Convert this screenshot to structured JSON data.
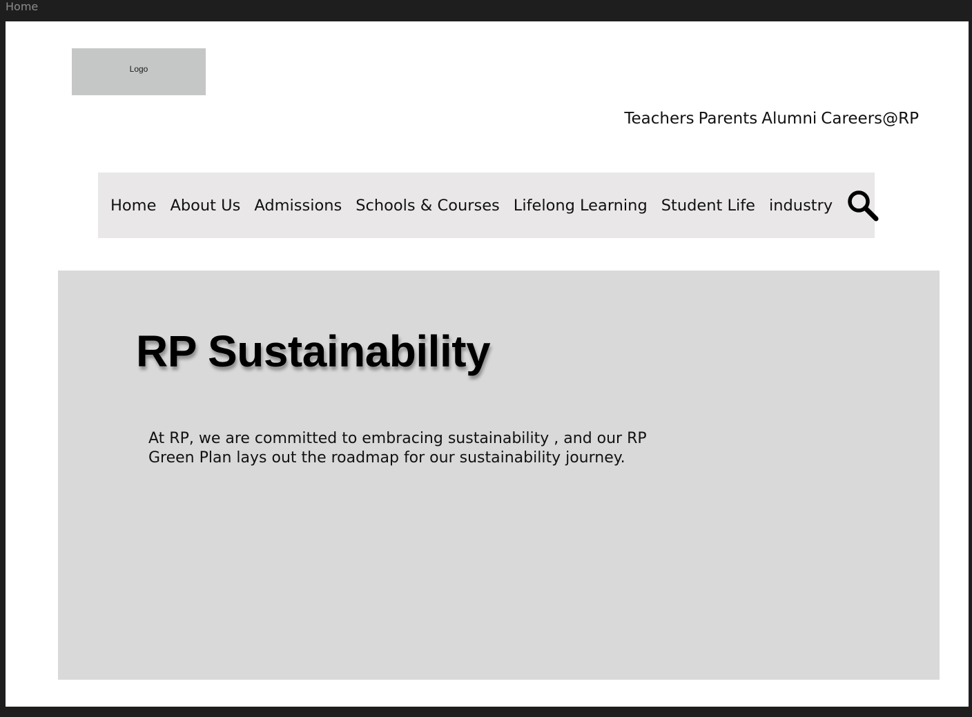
{
  "frame": {
    "label": "Home"
  },
  "header": {
    "logo_text": "Logo",
    "utility_links": [
      "Teachers",
      "Parents",
      "Alumni",
      "Careers@RP"
    ]
  },
  "nav": {
    "items": [
      "Home",
      "About Us",
      "Admissions",
      "Schools & Courses",
      "Lifelong Learning",
      "Student Life",
      "industry"
    ],
    "search_icon": "search-icon"
  },
  "hero": {
    "title": "RP Sustainability",
    "description": "At RP, we are committed to embracing sustainability , and our RP Green Plan lays out the roadmap for our sustainability journey."
  }
}
